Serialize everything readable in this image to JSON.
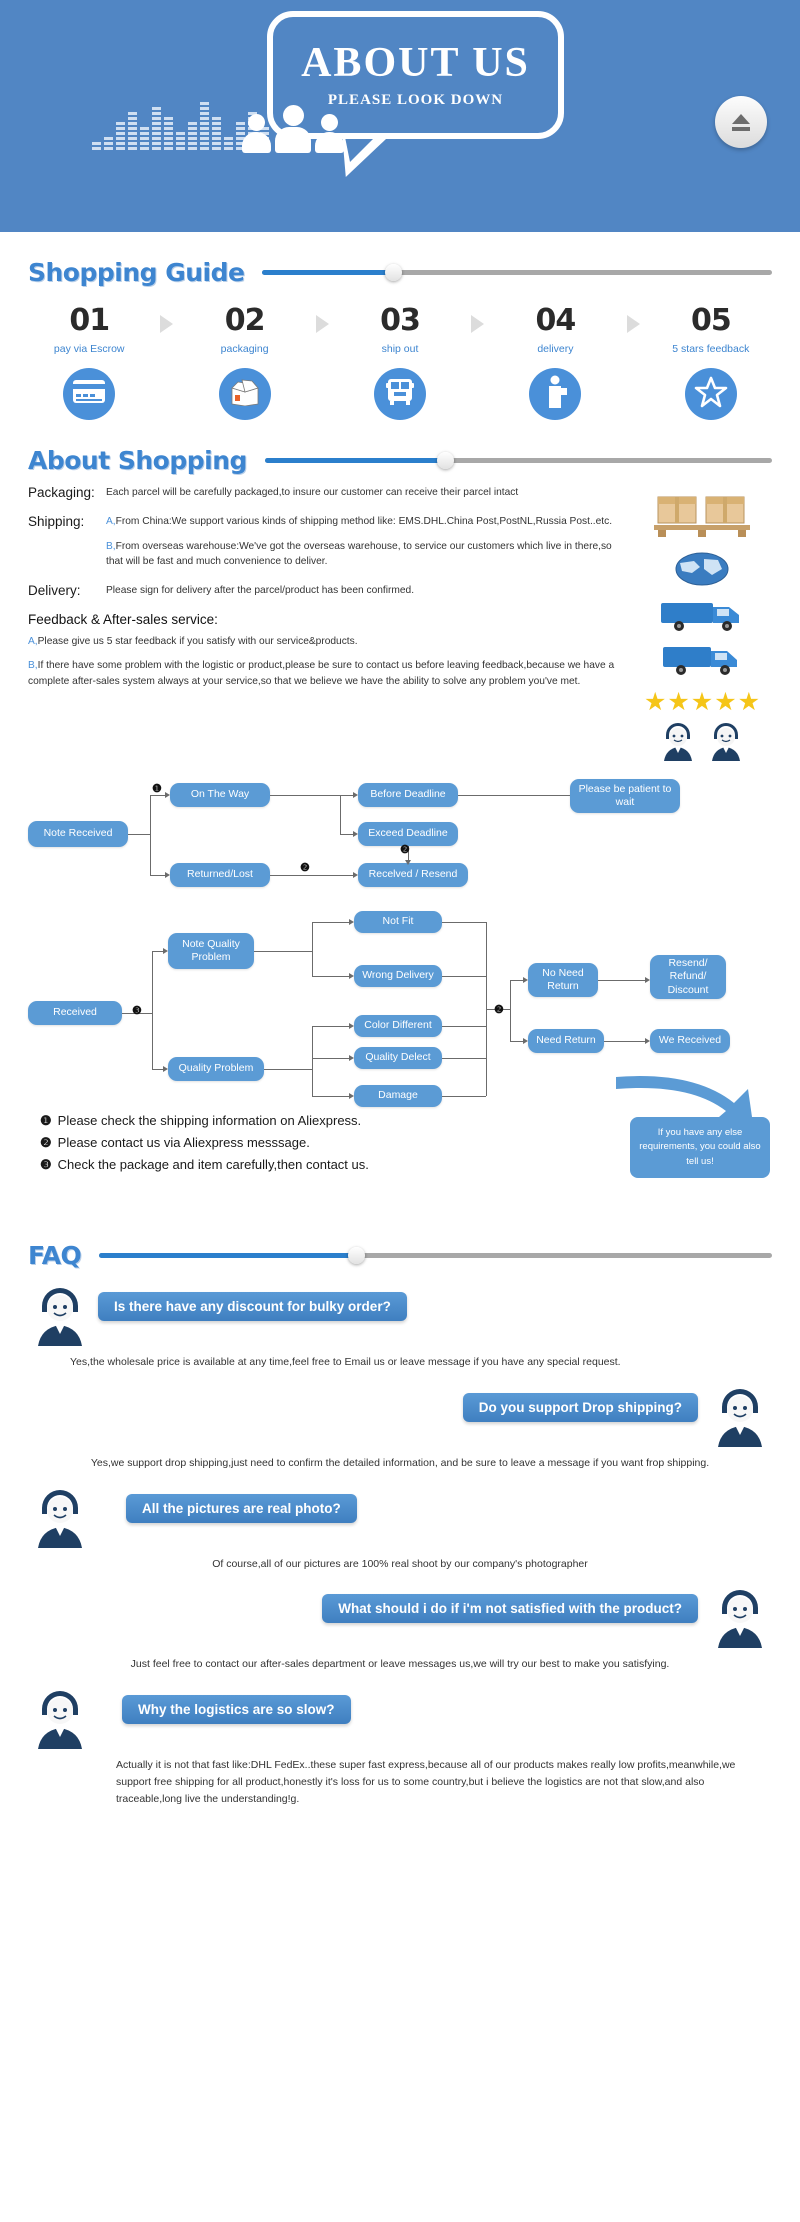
{
  "header": {
    "title": "ABOUT US",
    "subtitle": "PLEASE LOOK DOWN"
  },
  "shopping_guide": {
    "section_title": "Shopping Guide",
    "steps": [
      {
        "num": "01",
        "label": "pay via Escrow",
        "icon": "credit-card-icon"
      },
      {
        "num": "02",
        "label": "packaging",
        "icon": "open-box-icon"
      },
      {
        "num": "03",
        "label": "ship out",
        "icon": "bus-icon"
      },
      {
        "num": "04",
        "label": "delivery",
        "icon": "courier-person-icon"
      },
      {
        "num": "05",
        "label": "5 stars feedback",
        "icon": "star-icon"
      }
    ]
  },
  "about_shopping": {
    "section_title": "About Shopping",
    "packaging": {
      "label": "Packaging:",
      "text": "Each parcel will be carefully packaged,to insure our customer can receive their parcel intact"
    },
    "shipping": {
      "label": "Shipping:",
      "a_mark": "A,",
      "a_text": "From China:We support various kinds of shipping method like: EMS.DHL.China Post,PostNL,Russia Post..etc.",
      "b_mark": "B,",
      "b_text": "From overseas warehouse:We've got the overseas warehouse, to service our customers which live in there,so that will be fast and much convenience to deliver."
    },
    "delivery": {
      "label": "Delivery:",
      "text": "Please sign for delivery after the parcel/product has been confirmed."
    },
    "feedback": {
      "title": "Feedback & After-sales service:",
      "a_mark": "A,",
      "a_text": "Please give us 5 star feedback if you satisfy with our service&products.",
      "b_mark": "B,",
      "b_text": "If there have some problem with the logistic or product,please be sure to contact us before leaving feedback,because we have a complete after-sales system always at your service,so that we believe we have the ability to solve any problem you've met."
    }
  },
  "flowchart1": {
    "nodes": {
      "note_received": "Note Received",
      "on_the_way": "On The Way",
      "returned_lost": "Returned/Lost",
      "before_deadline": "Before Deadline",
      "exceed_deadline": "Exceed Deadline",
      "received_resend": "Recelved / Resend",
      "please_be_patient": "Please be patient to wait"
    },
    "markers": {
      "one": "❶",
      "two_a": "❷",
      "two_b": "❷"
    }
  },
  "flowchart2": {
    "nodes": {
      "received": "Received",
      "note_quality_problem": "Note Quality Problem",
      "quality_problem": "Quality Problem",
      "not_fit": "Not Fit",
      "wrong_delivery": "Wrong Delivery",
      "color_different": "Color Different",
      "quality_delect": "Quality Delect",
      "damage": "Damage",
      "no_need_return": "No Need Return",
      "need_return": "Need Return",
      "resend_refund_discount": "Resend/ Refund/ Discount",
      "we_received": "We Received"
    },
    "markers": {
      "three": "❸",
      "two": "❷"
    }
  },
  "notes": {
    "items": [
      {
        "bullet": "❶",
        "text": "Please check the shipping information on Aliexpress."
      },
      {
        "bullet": "❷",
        "text": "Please contact us via Aliexpress messsage."
      },
      {
        "bullet": "❸",
        "text": "Check the package and item carefully,then contact us."
      }
    ],
    "callout": "If you have any else requirements, you could also tell us!"
  },
  "faq": {
    "section_title": "FAQ",
    "items": [
      {
        "question": "Is there have any discount for bulky order?",
        "answer": "Yes,the wholesale price is available at any time,feel free to Email us or leave message if you have any special request.",
        "avatar_side": "left",
        "answer_align": "left"
      },
      {
        "question": "Do you support Drop shipping?",
        "answer": "Yes,we support drop shipping,just need to confirm the detailed information, and be sure to leave a message if you want frop shipping.",
        "avatar_side": "right",
        "answer_align": "center"
      },
      {
        "question": "All the pictures are real photo?",
        "answer": "Of course,all of our pictures are 100% real shoot by our company's photographer",
        "avatar_side": "left",
        "answer_align": "center"
      },
      {
        "question": "What should i do if i'm not satisfied with the product?",
        "answer": "Just feel free to contact our after-sales department or leave messages us,we will try our best to make you satisfying.",
        "avatar_side": "right",
        "answer_align": "center"
      },
      {
        "question": "Why the logistics are so slow?",
        "answer": "Actually it is not that fast like:DHL FedEx..these super fast express,because all of our products makes really low profits,meanwhile,we support free shipping for all product,honestly it's loss for us to some country,but i believe the logistics are not that slow,and also traceable,long live the understanding!g.",
        "avatar_side": "left",
        "answer_align": "left"
      }
    ]
  },
  "colors": {
    "brand_blue": "#5186c4",
    "accent_blue": "#3d85d0",
    "node_blue": "#5b9bd5",
    "star_yellow": "#f5c518"
  }
}
